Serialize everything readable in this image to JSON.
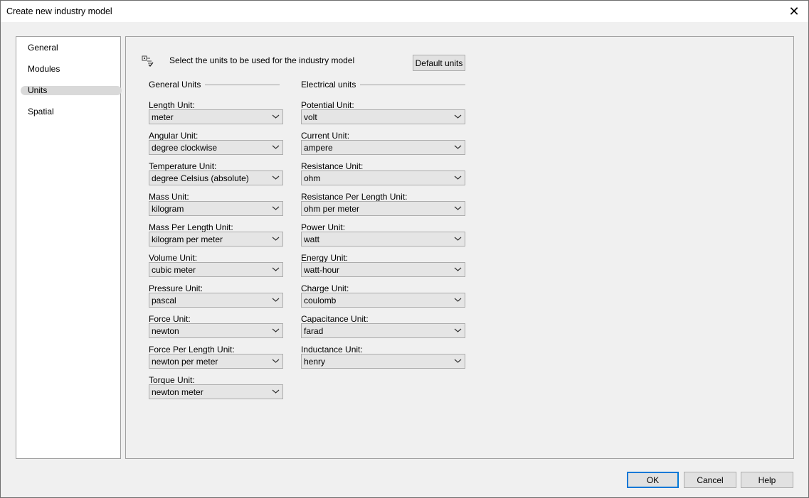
{
  "window": {
    "title": "Create new industry model",
    "close_glyph": "✕"
  },
  "nav": {
    "items": [
      {
        "label": "General",
        "selected": false
      },
      {
        "label": "Modules",
        "selected": false
      },
      {
        "label": "Units",
        "selected": true
      },
      {
        "label": "Spatial",
        "selected": false
      }
    ]
  },
  "header": {
    "icon": "units-settings-icon",
    "text": "Select the units to be used for the industry model",
    "default_button": "Default units"
  },
  "general_units": {
    "title": "General Units",
    "fields": [
      {
        "label": "Length Unit:",
        "value": "meter"
      },
      {
        "label": "Angular Unit:",
        "value": "degree clockwise"
      },
      {
        "label": "Temperature Unit:",
        "value": "degree Celsius (absolute)"
      },
      {
        "label": "Mass Unit:",
        "value": "kilogram"
      },
      {
        "label": "Mass Per Length Unit:",
        "value": "kilogram per meter"
      },
      {
        "label": "Volume Unit:",
        "value": "cubic meter"
      },
      {
        "label": "Pressure Unit:",
        "value": "pascal"
      },
      {
        "label": "Force Unit:",
        "value": "newton"
      },
      {
        "label": "Force Per Length Unit:",
        "value": "newton per meter"
      },
      {
        "label": "Torque Unit:",
        "value": "newton meter"
      }
    ]
  },
  "electrical_units": {
    "title": "Electrical units",
    "fields": [
      {
        "label": "Potential Unit:",
        "value": "volt"
      },
      {
        "label": "Current Unit:",
        "value": "ampere"
      },
      {
        "label": "Resistance Unit:",
        "value": "ohm"
      },
      {
        "label": "Resistance Per Length Unit:",
        "value": "ohm per meter"
      },
      {
        "label": "Power Unit:",
        "value": "watt"
      },
      {
        "label": "Energy Unit:",
        "value": "watt-hour"
      },
      {
        "label": "Charge Unit:",
        "value": "coulomb"
      },
      {
        "label": "Capacitance Unit:",
        "value": "farad"
      },
      {
        "label": "Inductance Unit:",
        "value": "henry"
      }
    ]
  },
  "footer": {
    "ok": "OK",
    "cancel": "Cancel",
    "help": "Help"
  },
  "colors": {
    "accent": "#0078d7",
    "panel_border": "#a0a0a0",
    "select_bg": "#e5e5e5"
  }
}
